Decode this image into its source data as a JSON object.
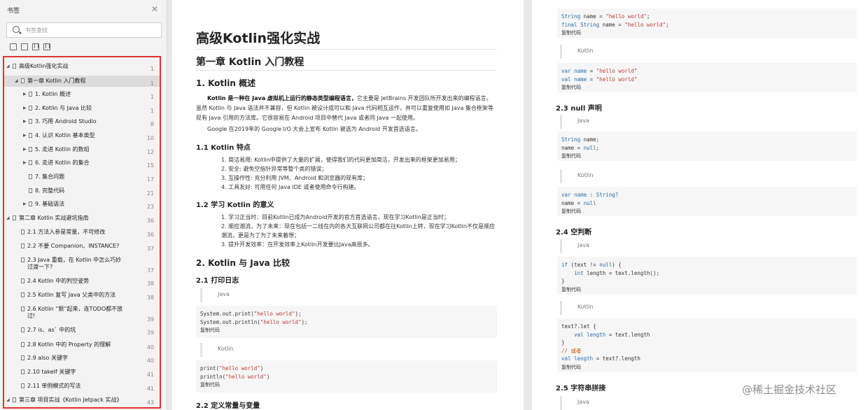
{
  "sidebar": {
    "title": "书签",
    "search_placeholder": "书签查找",
    "items": [
      {
        "label": "高级Kotlin强化实战",
        "page": "1"
      },
      {
        "label": "第一章 Kotlin 入门教程",
        "page": "1"
      },
      {
        "label": "1. Kotlin 概述",
        "page": "1"
      },
      {
        "label": "2. Kotlin 与 Java 比较",
        "page": "1"
      },
      {
        "label": "3. 巧用 Android Studio",
        "page": "8"
      },
      {
        "label": "4. 认识 Kotlin 基本类型",
        "page": "10"
      },
      {
        "label": "5. 走进 Kotlin 的数组",
        "page": "12"
      },
      {
        "label": "6. 走进 Kotlin 的集合",
        "page": "15"
      },
      {
        "label": "7. 集合问题",
        "page": "17"
      },
      {
        "label": "8. 完整代码",
        "page": "21"
      },
      {
        "label": "9. 基础语法",
        "page": "23"
      },
      {
        "label": "第二章 Kotlin 实战避坑指南",
        "page": "36"
      },
      {
        "label": "2.1 方法入参是常量，不可修改",
        "page": "36"
      },
      {
        "label": "2.2 不要 Companion、INSTANCE?",
        "page": "37"
      },
      {
        "label": "2.3 Java 重载，在 Kotlin 中怎么巧妙过渡一下?",
        "page": "37"
      },
      {
        "label": "2.4 Kotlin 中的判空姿势",
        "page": "38"
      },
      {
        "label": "2.5 Kotlin 复写 Java 父类中的方法",
        "page": "38"
      },
      {
        "label": "2.6 Kotlin “狠”起来，连TODO都不放过!",
        "page": "39"
      },
      {
        "label": "2.7 is、as` 中的坑",
        "page": "39"
      },
      {
        "label": "2.8 Kotlin 中的 Property 的理解",
        "page": "40"
      },
      {
        "label": "2.9 also 关键字",
        "page": "40"
      },
      {
        "label": "2.10 takeIf 关键字",
        "page": "41"
      },
      {
        "label": "2.11 单例模式的写法",
        "page": "41"
      },
      {
        "label": "第三章 项目实战《Kotlin Jetpack 实战》",
        "page": "43"
      }
    ]
  },
  "page1": {
    "title": "高级Kotlin强化实战",
    "chapter": "第一章 Kotlin 入门教程",
    "s1": "1. Kotlin 概述",
    "intro_a": "Kotlin 是一种在 Java 虚拟机上运行的静态类型编程语言，",
    "intro_b": "它主要是 JetBrains 开发团队所开发出来的编程语言。虽然 Kotlin 与 Java 语法并不兼容，但 Kotlin 被设计成可以和 Java 代码相互运作，并可以重复使用如 Java 集合框架等现有 Java 引用的方法库。它很容易在 Android 项目中替代 Java 或者同 Java 一起使用。",
    "google": "Google 在2019年的 Google I/O 大会上宣布 Kotlin 被选为 Android 开发首选语言。",
    "s11": "1.1 Kotlin 特点",
    "features": [
      "1. 简洁易用: Kotlin中提供了大量的扩展，使得我们的代码更加简洁，开发出来的框架更加易用；",
      "2. 安全: 避免空指针异常等整个类的错误；",
      "3. 互操作性: 充分利用 JVM、Android 和浏览器的现有库；",
      "4. 工具友好: 可用任何 Java IDE 或者使用命令行构建。"
    ],
    "s12": "1.2 学习 Kotlin 的意义",
    "reasons": [
      "1. 学习正当时：目前Kotlin已成为Android开发的官方首选语言，现在学习Kotlin是正当时；",
      "2. 顺应潮流，为了未来：现在包括一二线在内的各大互联网公司都在往Kotlin上转，现在学习Kotlin不仅是顺应潮流，更是为了为了未来着想；",
      "3. 提升开发效率：在开发效率上Kotlin开发要比Java高很多。"
    ],
    "s2": "2. Kotlin 与 Java 比较",
    "s21": "2.1 打印日志",
    "lang_java": "Java",
    "code_java_1": "System.out.print(",
    "code_java_2": "System.out.println(",
    "hello": "\"hello world\"",
    "copy": "复制代码",
    "lang_kotlin": "Kotlin",
    "code_kt_1": "print(",
    "code_kt_2": "println(",
    "s22": "2.2 定义常量与变量"
  },
  "page2": {
    "s23": "2.3 null 声明",
    "s24": "2.4 空判断",
    "s25": "2.5 字符串拼接",
    "lang_java": "Java",
    "lang_kotlin": "Kotlin",
    "copy": "复制代码"
  },
  "watermark": "@稀土掘金技术社区"
}
